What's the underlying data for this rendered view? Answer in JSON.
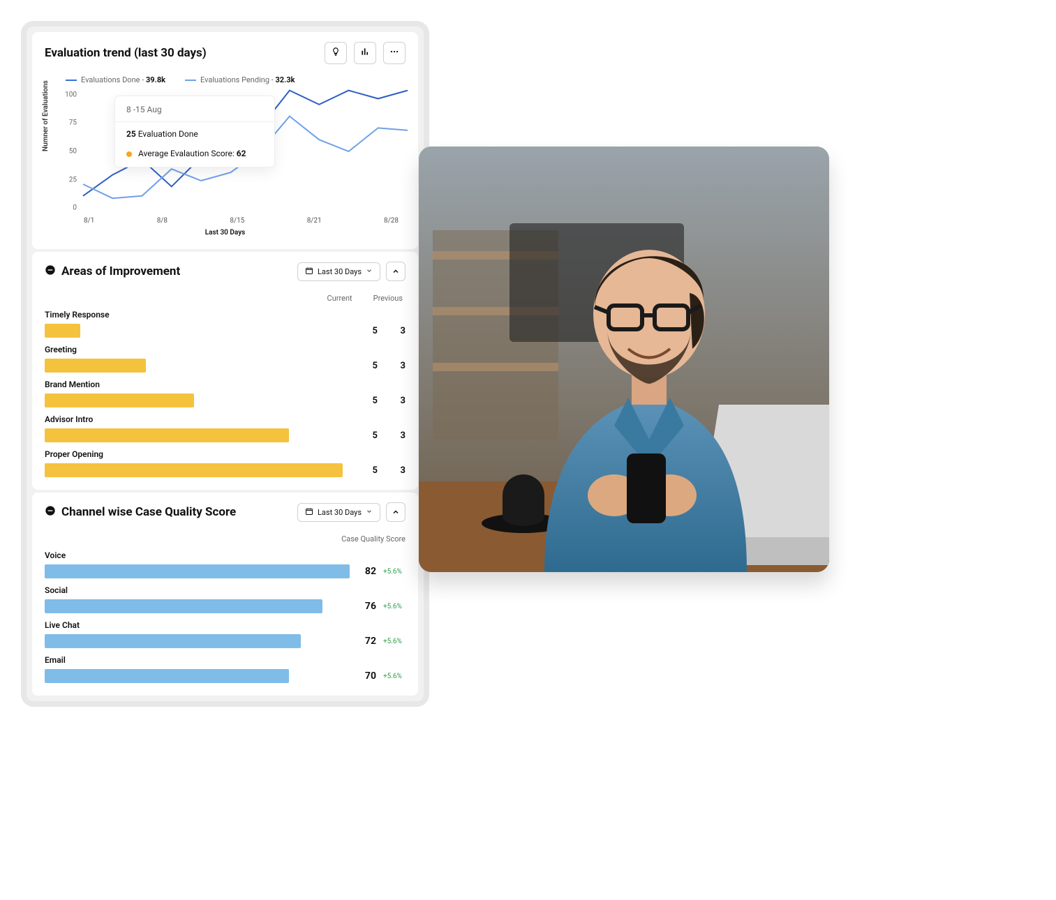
{
  "chart_data": [
    {
      "id": "evaluation_trend",
      "type": "line",
      "title": "Evaluation trend (last 30 days)",
      "ylabel": "Numner of Evaluations",
      "xlabel": "Last 30 Days",
      "ylim": [
        0,
        100
      ],
      "yticks": [
        0,
        25,
        50,
        75,
        100
      ],
      "categories": [
        "8/1",
        "8/8",
        "8/15",
        "8/21",
        "8/28"
      ],
      "series": [
        {
          "name": "Evaluations Done",
          "total": "39.8k",
          "values": [
            12,
            30,
            43,
            20,
            45,
            52,
            70,
            102,
            90,
            102,
            95,
            102
          ]
        },
        {
          "name": "Evaluations Pending",
          "total": "32.3k",
          "values": [
            22,
            10,
            12,
            35,
            25,
            32,
            50,
            80,
            60,
            50,
            70,
            68
          ]
        }
      ],
      "tooltip": {
        "range": "8 -15 Aug",
        "count": 25,
        "count_label": "Evaluation Done",
        "avg_label": "Average Evalaution Score:",
        "avg_score": 62
      }
    },
    {
      "id": "areas_of_improvement",
      "type": "bar",
      "title": "Areas of Improvement",
      "columns": [
        "Current",
        "Previous"
      ],
      "max_bar": 100,
      "rows": [
        {
          "label": "Timely Response",
          "bar": 12,
          "current": 5,
          "previous": 3
        },
        {
          "label": "Greeting",
          "bar": 34,
          "current": 5,
          "previous": 3
        },
        {
          "label": "Brand Mention",
          "bar": 50,
          "current": 5,
          "previous": 3
        },
        {
          "label": "Advisor Intro",
          "bar": 82,
          "current": 5,
          "previous": 3
        },
        {
          "label": "Proper Opening",
          "bar": 100,
          "current": 5,
          "previous": 3
        }
      ]
    },
    {
      "id": "channel_quality",
      "type": "bar",
      "title": "Channel wise Case Quality Score",
      "score_label": "Case Quality Score",
      "max_bar": 100,
      "rows": [
        {
          "label": "Voice",
          "bar": 100,
          "score": 82,
          "delta": "+5.6%"
        },
        {
          "label": "Social",
          "bar": 91,
          "score": 76,
          "delta": "+5.6%"
        },
        {
          "label": "Live Chat",
          "bar": 84,
          "score": 72,
          "delta": "+5.6%"
        },
        {
          "label": "Email",
          "bar": 80,
          "score": 70,
          "delta": "+5.6%"
        }
      ]
    }
  ],
  "toolbar": {
    "insight_icon": "lightbulb-icon",
    "chart_icon": "bar-chart-icon",
    "more_icon": "more-icon"
  },
  "filters": {
    "date_label": "Last 30 Days"
  }
}
